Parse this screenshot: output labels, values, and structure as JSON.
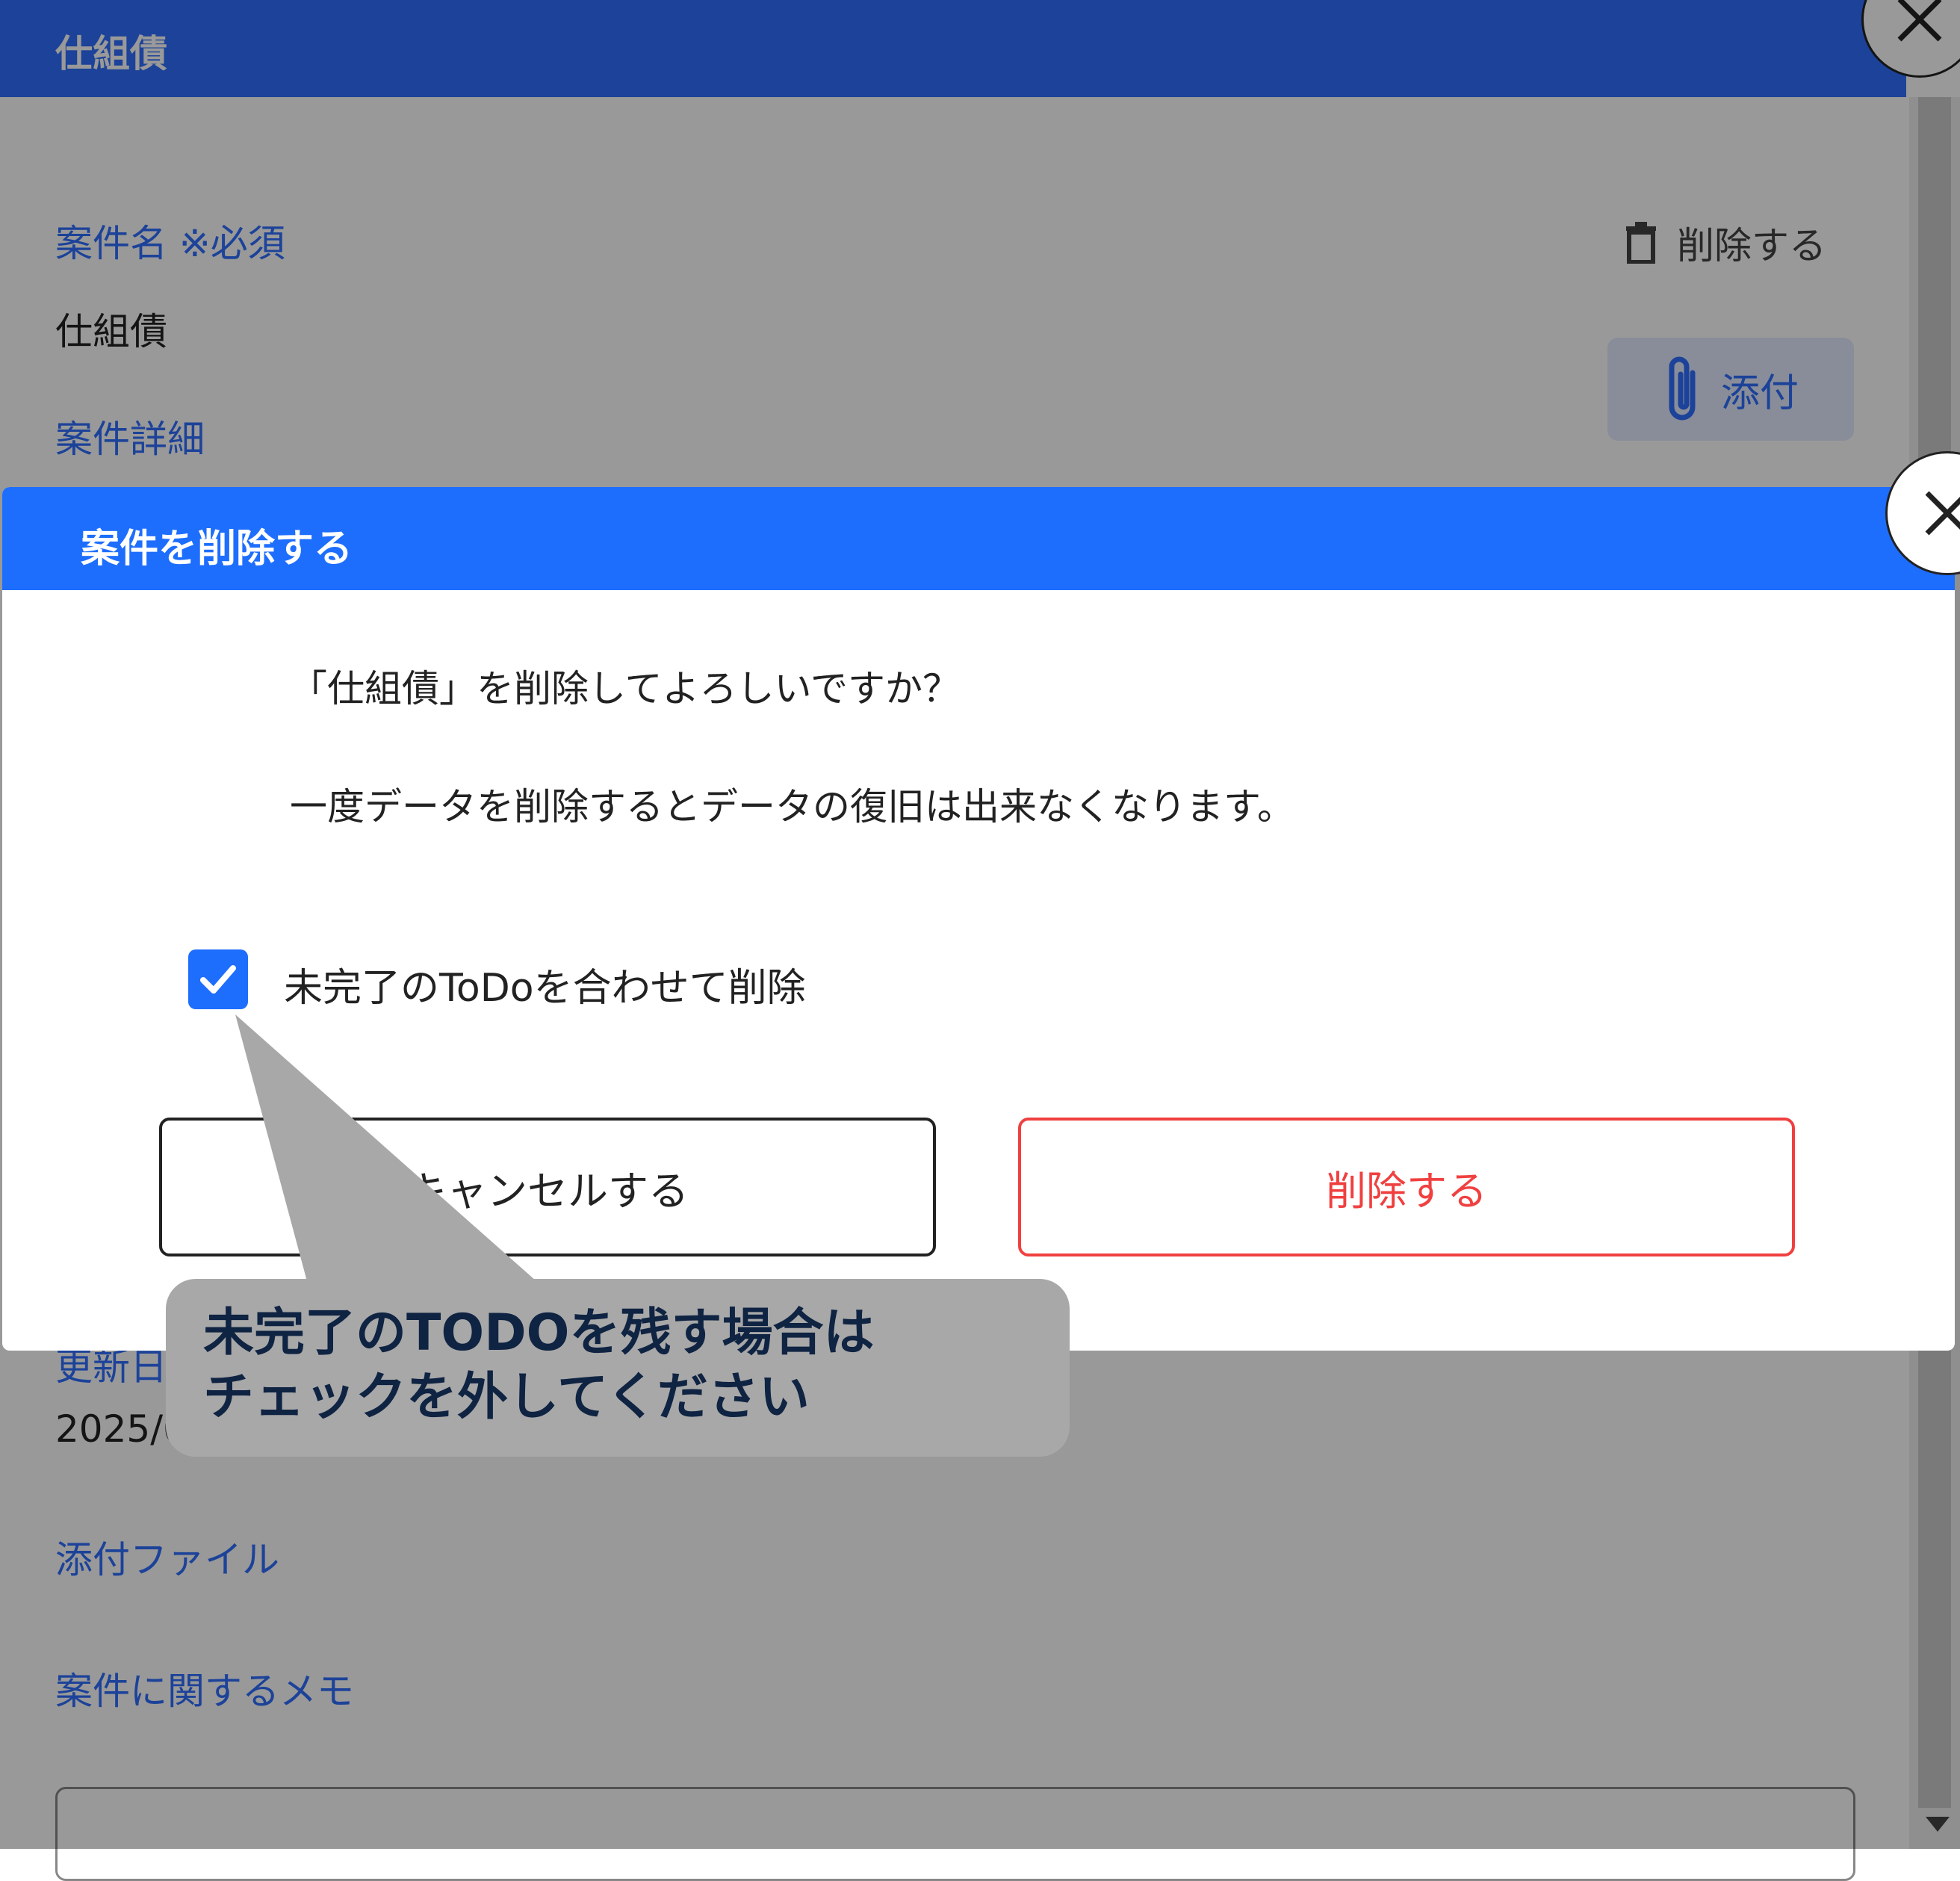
{
  "panel": {
    "header_title": "仕組債",
    "name_label": "案件名 ※必須",
    "name_value": "仕組債",
    "detail_label": "案件詳細",
    "updated_label": "更新日",
    "updated_value": "2025/0",
    "attachments_label": "添付ファイル",
    "memo_label": "案件に関するメモ",
    "delete_action": "削除する",
    "attach_button": "添付"
  },
  "dialog": {
    "title": "案件を削除する",
    "message_line1": "「仕組債」を削除してよろしいですか？",
    "message_line2": "一度データを削除するとデータの復旧は出来なくなります。",
    "checkbox_label": "未完了のToDoを合わせて削除",
    "checkbox_checked": true,
    "cancel_button": "キャンセルする",
    "delete_button": "削除する"
  },
  "callout": {
    "line1": "未完了のTODOを残す場合は",
    "line2": "チェックを外してください"
  },
  "colors": {
    "header_blue": "#2f6fff",
    "dialog_blue": "#1e6efd",
    "danger_red": "#f04040",
    "callout_gray": "#a8a8a8",
    "callout_text": "#0f2342"
  }
}
